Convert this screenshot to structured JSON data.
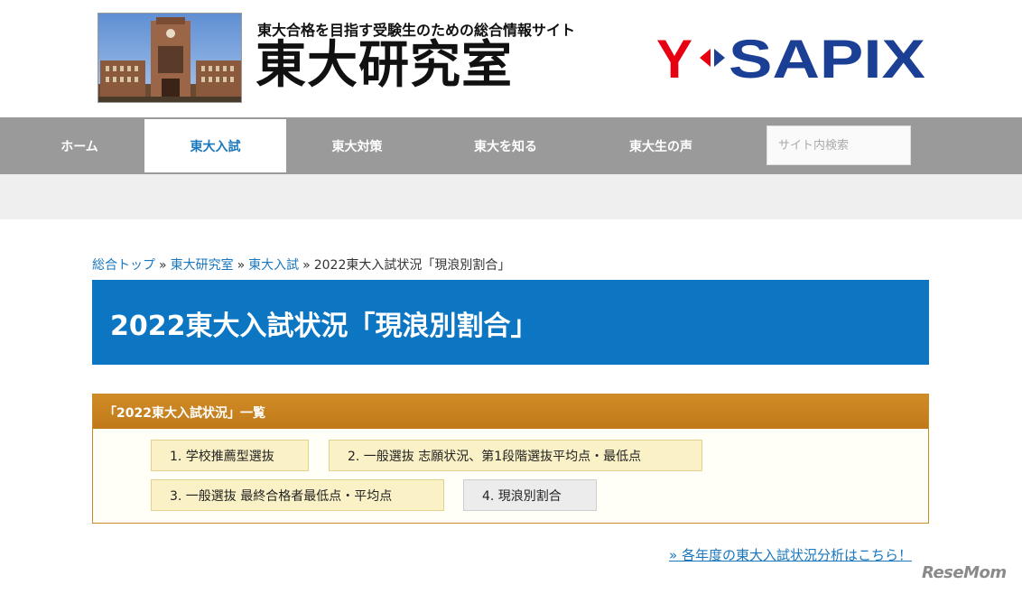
{
  "header": {
    "tagline": "東大合格を目指す受験生のための総合情報サイト",
    "site_title": "東大研究室",
    "brand": "Y-SAPIX"
  },
  "nav": {
    "items": [
      {
        "label": "ホーム"
      },
      {
        "label": "東大入試",
        "active": true
      },
      {
        "label": "東大対策"
      },
      {
        "label": "東大を知る"
      },
      {
        "label": "東大生の声"
      }
    ],
    "search_placeholder": "サイト内検索"
  },
  "breadcrumb": {
    "links": [
      "総合トップ",
      "東大研究室",
      "東大入試"
    ],
    "separator": "»",
    "current": "2022東大入試状況「現浪別割合」"
  },
  "page_title": "2022東大入試状況「現浪別割合」",
  "panel": {
    "title": "「2022東大入試状況」一覧",
    "items": [
      {
        "label": "1. 学校推薦型選抜"
      },
      {
        "label": "2. 一般選抜 志願状況、第1段階選抜平均点・最低点"
      },
      {
        "label": "3. 一般選抜 最終合格者最低点・平均点"
      },
      {
        "label": "4.  現浪別割合",
        "current": true
      }
    ]
  },
  "more_link": "» 各年度の東大入試状況分析はこちら！",
  "watermark": "ReseMom",
  "colors": {
    "nav_bg": "#9b9a9a",
    "accent_blue": "#0d76c3",
    "link": "#1a77bd",
    "panel_head": "#c88a27",
    "pill": "#fbf1c6",
    "brand_red": "#e60012",
    "brand_blue": "#1b3f94"
  }
}
